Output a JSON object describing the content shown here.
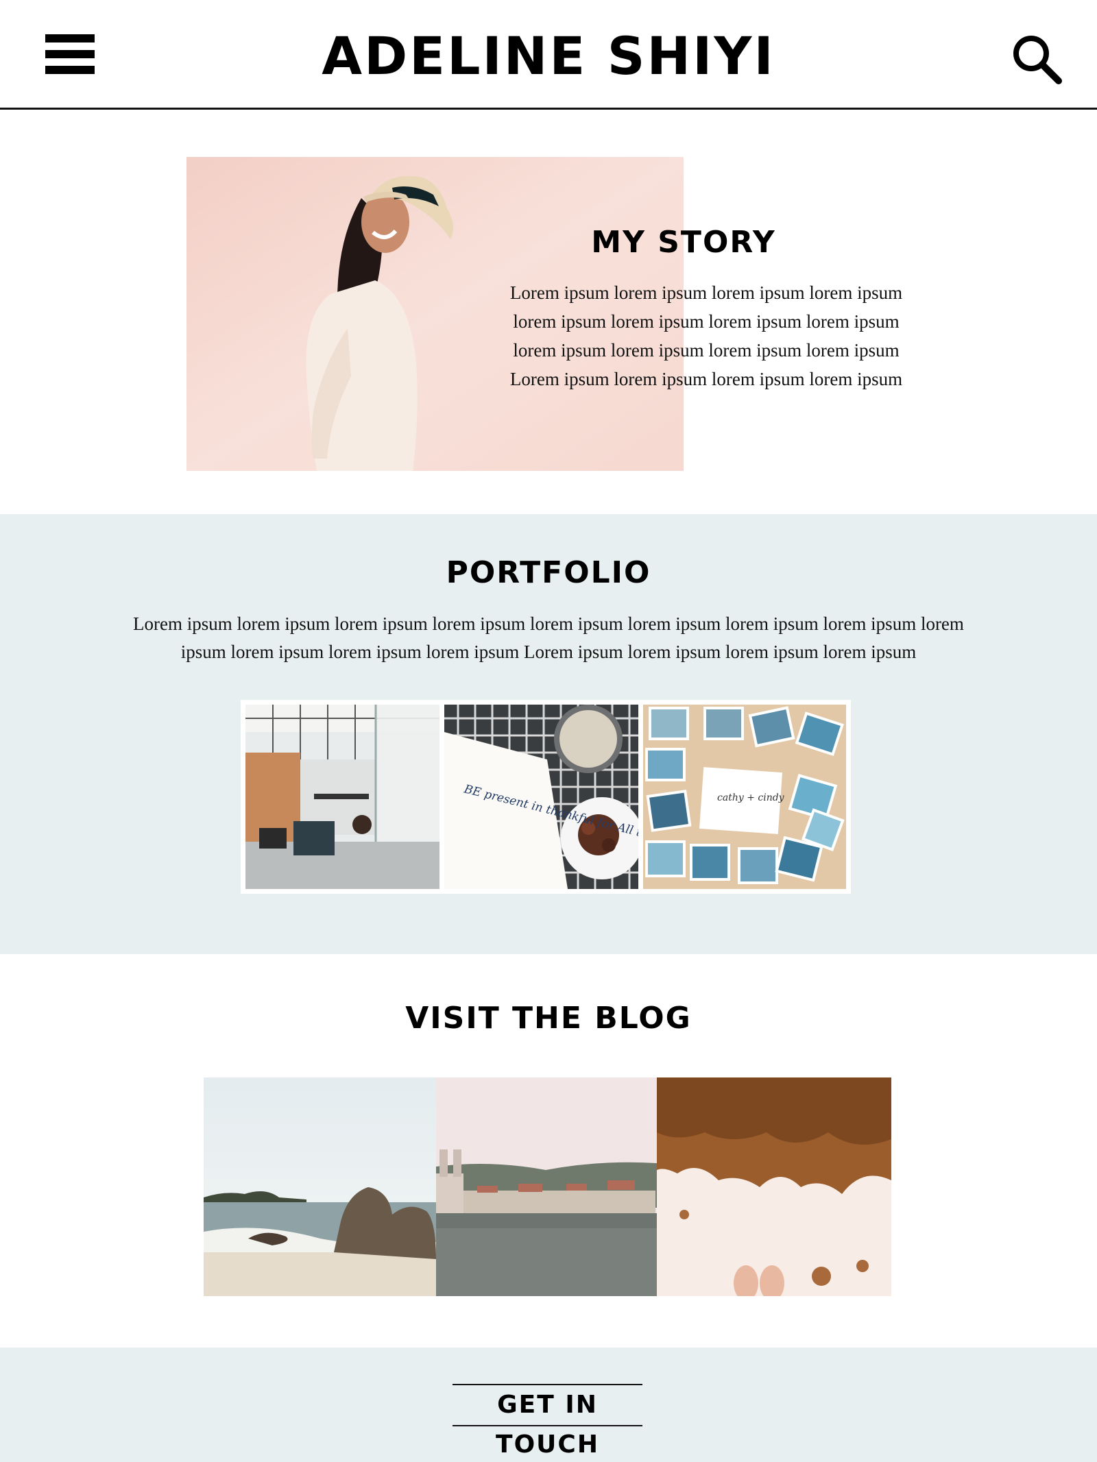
{
  "header": {
    "title": "ADELINE SHIYI",
    "menu_icon": "hamburger-menu-icon",
    "search_icon": "search-icon"
  },
  "story": {
    "title": "MY STORY",
    "lines": [
      "Lorem ipsum lorem ipsum lorem ipsum lorem ipsum",
      "lorem ipsum lorem ipsum lorem ipsum lorem ipsum",
      "lorem ipsum lorem ipsum lorem ipsum lorem ipsum",
      "Lorem ipsum lorem ipsum lorem ipsum lorem ipsum"
    ]
  },
  "portfolio": {
    "title": "PORTFOLIO",
    "lines": [
      "Lorem ipsum lorem ipsum lorem ipsum lorem ipsum lorem ipsum lorem ipsum lorem ipsum lorem ipsum lorem",
      "ipsum lorem ipsum lorem ipsum lorem ipsum Lorem ipsum lorem ipsum lorem ipsum lorem ipsum"
    ],
    "note_text": "BE present in thankful for All things",
    "card_text": "cathy + cindy"
  },
  "blog": {
    "title": "VISIT THE BLOG"
  },
  "footer": {
    "cta": "GET IN TOUCH"
  },
  "colors": {
    "accent_bg": "#e8eff0",
    "text": "#111111",
    "story_photo_bg": "#f6d9d1"
  }
}
